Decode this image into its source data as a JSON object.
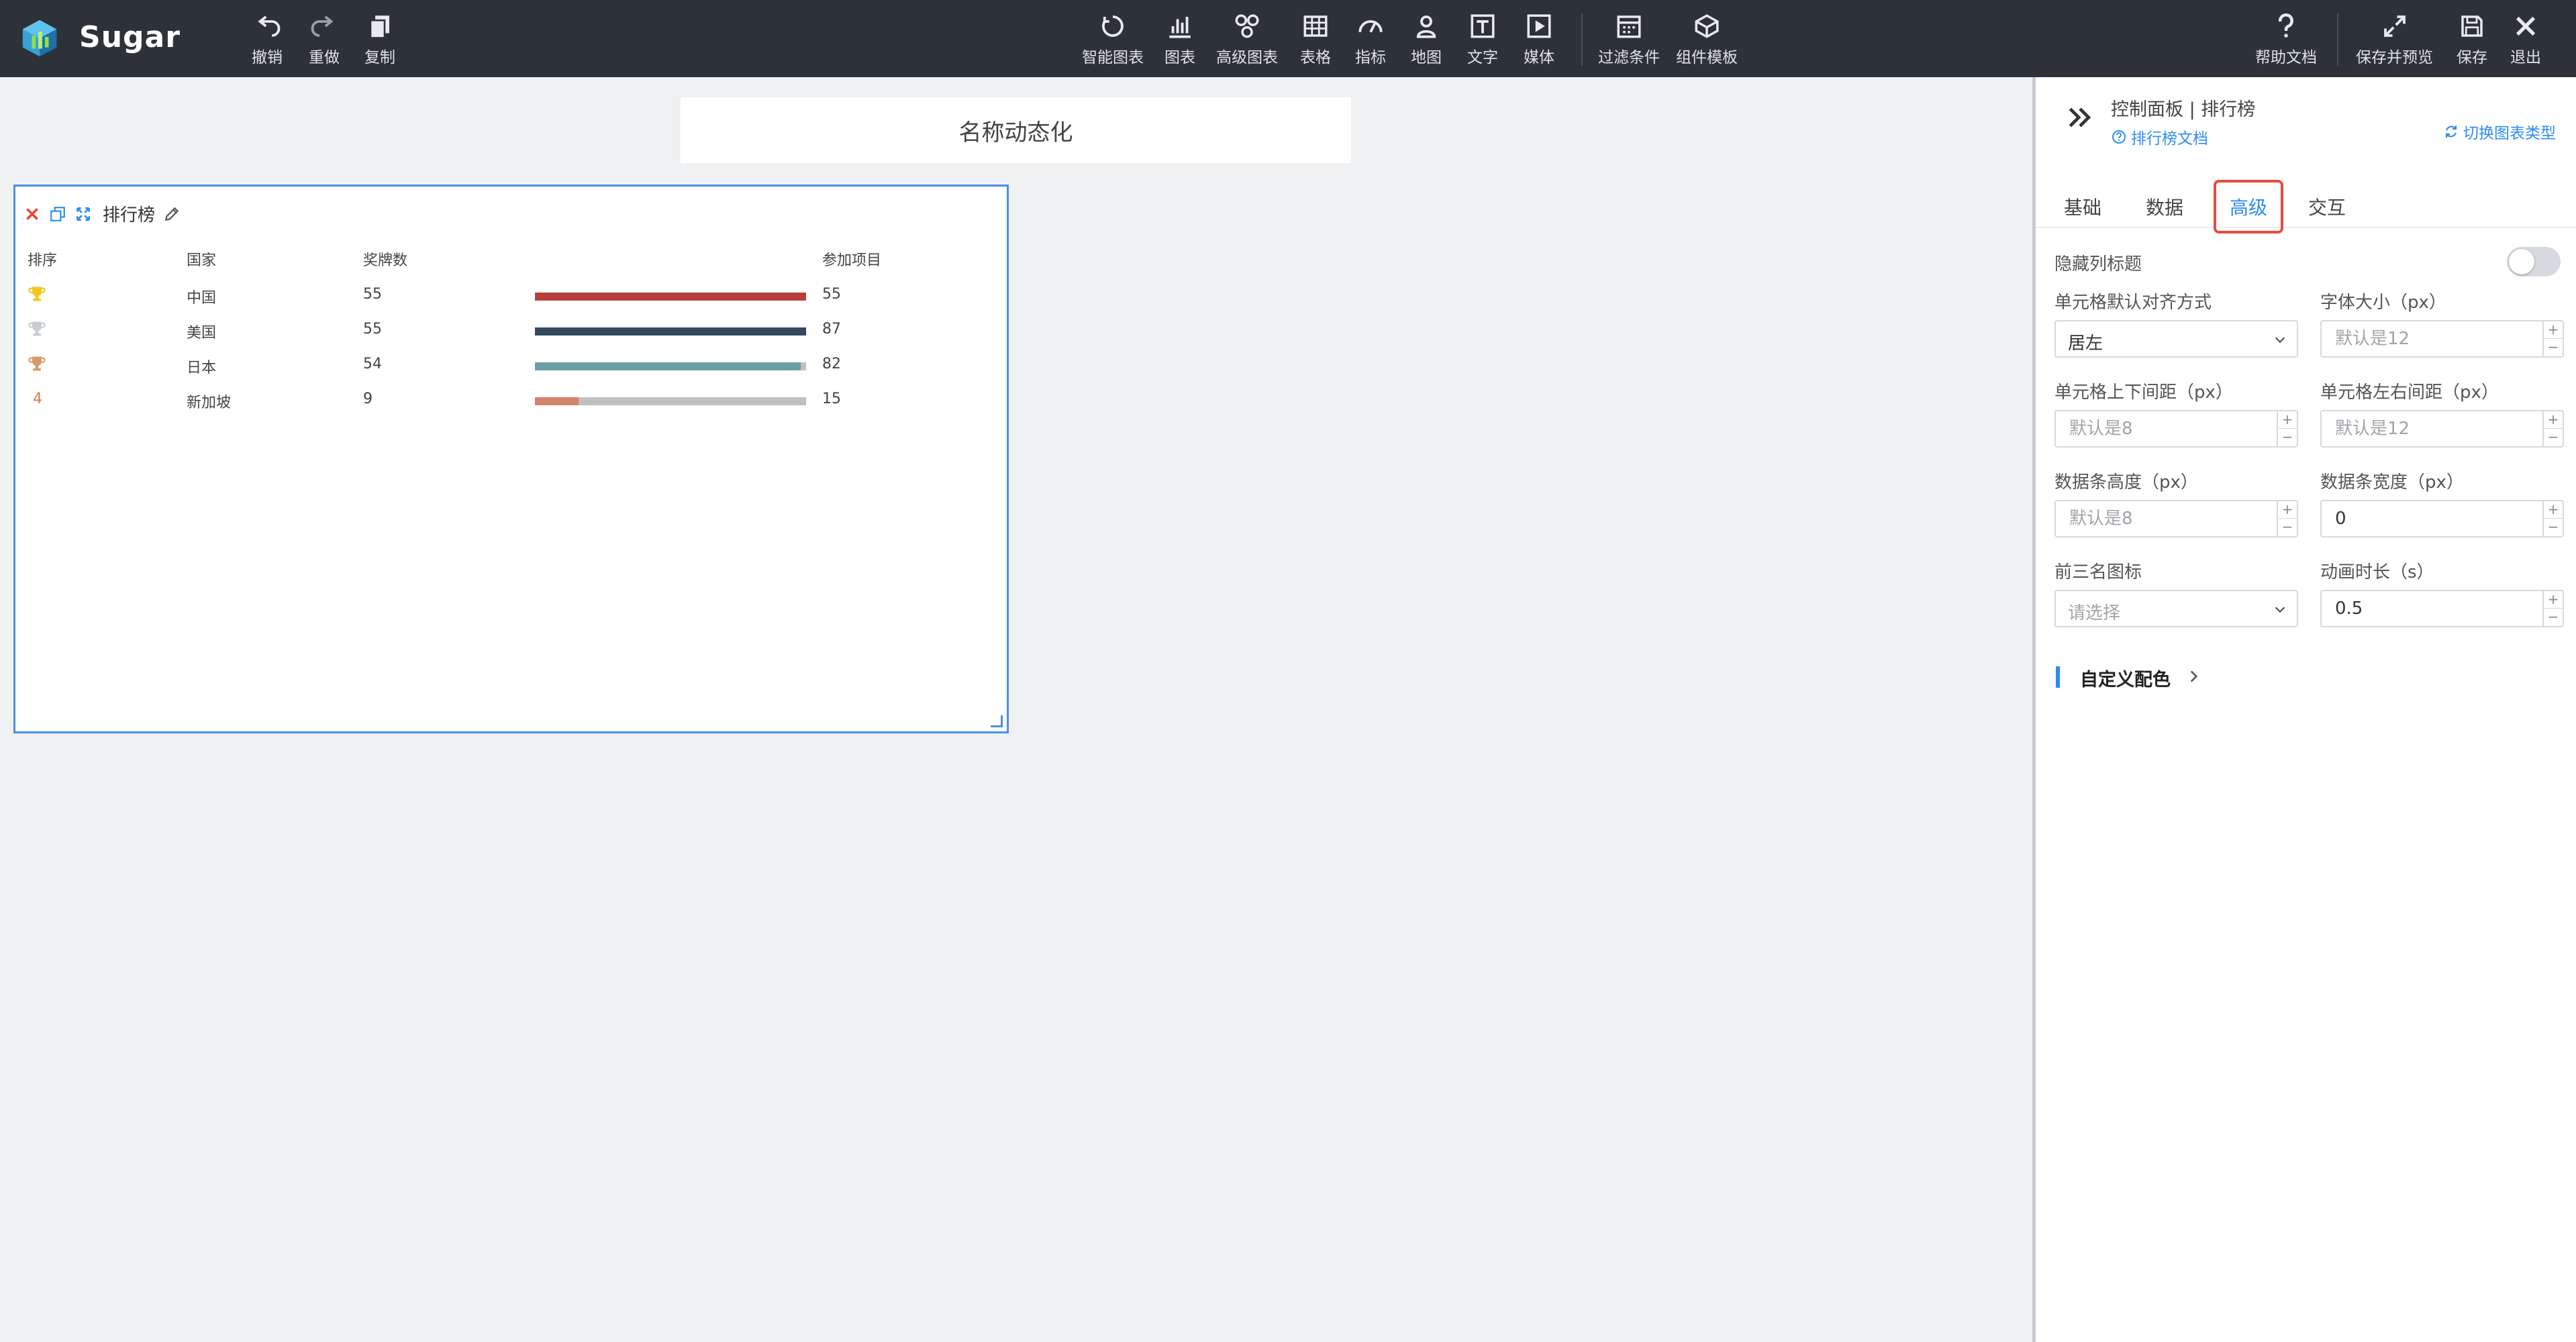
{
  "app": {
    "brand": "Sugar"
  },
  "toolbar": {
    "undo": "撤销",
    "redo": "重做",
    "copy": "复制",
    "smart_chart": "智能图表",
    "chart": "图表",
    "advanced_chart": "高级图表",
    "table": "表格",
    "indicator": "指标",
    "map": "地图",
    "text": "文字",
    "media": "媒体",
    "filter": "过滤条件",
    "component_template": "组件模板",
    "help": "帮助文档",
    "save_preview": "保存并预览",
    "save": "保存",
    "exit": "退出"
  },
  "canvas": {
    "title_card": "名称动态化",
    "widget": {
      "title": "排行榜",
      "columns": [
        "排序",
        "国家",
        "奖牌数",
        "参加项目"
      ],
      "rows": [
        {
          "rank": "1",
          "trophy": "gold-trophy-icon",
          "country": "中国",
          "medals": "55",
          "projects": "55",
          "fill": 1.0,
          "color": "#b7403d"
        },
        {
          "rank": "2",
          "trophy": "silver-trophy-icon",
          "country": "美国",
          "medals": "55",
          "projects": "87",
          "fill": 1.0,
          "color": "#34495e"
        },
        {
          "rank": "3",
          "trophy": "bronze-trophy-icon",
          "country": "日本",
          "medals": "54",
          "projects": "82",
          "fill": 0.98,
          "color": "#6a9fa6"
        },
        {
          "rank": "4",
          "trophy": "",
          "country": "新加坡",
          "medals": "9",
          "projects": "15",
          "fill": 0.16,
          "color": "#d4826a"
        }
      ]
    }
  },
  "panel": {
    "title": "控制面板 | 排行榜",
    "doc_link": "排行榜文档",
    "switch_type": "切换图表类型",
    "tabs": [
      "基础",
      "数据",
      "高级",
      "交互"
    ],
    "active_tab": "高级",
    "hide_col_title": "隐藏列标题",
    "cell_align_label": "单元格默认对齐方式",
    "cell_align_value": "居左",
    "font_size_label": "字体大小（px）",
    "font_size_placeholder": "默认是12",
    "cell_vpad_label": "单元格上下间距（px）",
    "cell_vpad_placeholder": "默认是8",
    "cell_hpad_label": "单元格左右间距（px）",
    "cell_hpad_placeholder": "默认是12",
    "bar_height_label": "数据条高度（px）",
    "bar_height_placeholder": "默认是8",
    "bar_width_label": "数据条宽度（px）",
    "bar_width_value": "0",
    "top3_icon_label": "前三名图标",
    "top3_icon_placeholder": "请选择",
    "anim_label": "动画时长（s）",
    "anim_value": "0.5",
    "custom_color": "自定义配色"
  },
  "colors": {
    "accent": "#2d8cf0",
    "topbar": "#2d3238",
    "highlight": "#e74c3c"
  }
}
